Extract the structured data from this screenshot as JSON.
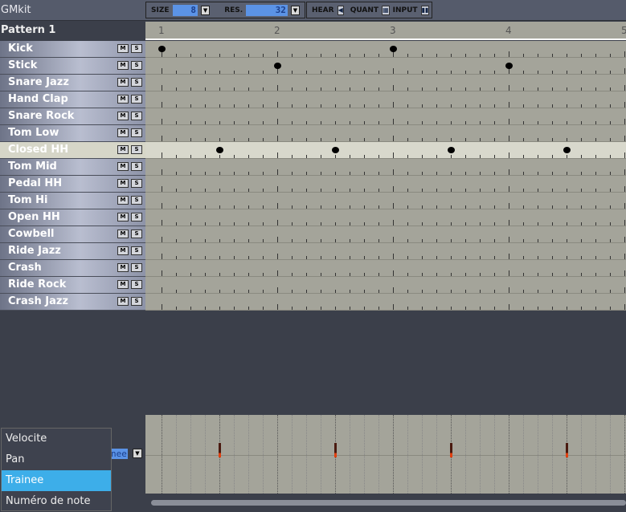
{
  "header": {
    "kit_name": "GMkit",
    "size_label": "SIZE",
    "size_value": "8",
    "res_label": "RES.",
    "res_value": "32",
    "hear_label": "HEAR",
    "quant_label": "QUANT",
    "input_label": "INPUT"
  },
  "pattern": {
    "name": "Pattern 1",
    "beats": [
      "1",
      "2",
      "3",
      "4",
      "5"
    ],
    "mute_label": "M",
    "solo_label": "S"
  },
  "instruments": [
    {
      "name": "Kick",
      "notes": [
        0,
        2
      ]
    },
    {
      "name": "Stick",
      "notes": [
        1,
        3
      ]
    },
    {
      "name": "Snare Jazz",
      "notes": []
    },
    {
      "name": "Hand Clap",
      "notes": []
    },
    {
      "name": "Snare Rock",
      "notes": []
    },
    {
      "name": "Tom Low",
      "notes": []
    },
    {
      "name": "Closed HH",
      "notes": [
        0.5,
        1.5,
        2.5,
        3.5
      ],
      "selected": true
    },
    {
      "name": "Tom Mid",
      "notes": []
    },
    {
      "name": "Pedal HH",
      "notes": []
    },
    {
      "name": "Tom Hi",
      "notes": []
    },
    {
      "name": "Open HH",
      "notes": []
    },
    {
      "name": "Cowbell",
      "notes": []
    },
    {
      "name": "Ride Jazz",
      "notes": []
    },
    {
      "name": "Crash",
      "notes": []
    },
    {
      "name": "Ride Rock",
      "notes": []
    },
    {
      "name": "Crash Jazz",
      "notes": []
    }
  ],
  "editor": {
    "combo_value": "nee",
    "menu": [
      {
        "label": "Velocite"
      },
      {
        "label": "Pan"
      },
      {
        "label": "Trainee",
        "selected": true
      },
      {
        "label": "Numéro de note"
      }
    ]
  }
}
